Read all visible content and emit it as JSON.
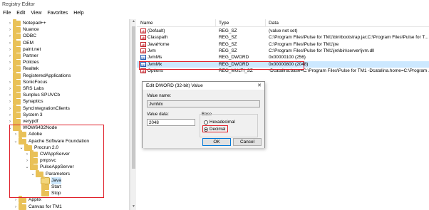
{
  "window": {
    "title": "Registry Editor"
  },
  "menu": [
    "File",
    "Edit",
    "View",
    "Favorites",
    "Help"
  ],
  "tree": [
    {
      "label": "Notepad++",
      "indent": 2,
      "chevron": ">"
    },
    {
      "label": "Nuance",
      "indent": 2,
      "chevron": ">"
    },
    {
      "label": "ODBC",
      "indent": 2,
      "chevron": ">"
    },
    {
      "label": "OEM",
      "indent": 2,
      "chevron": ">"
    },
    {
      "label": "paint.net",
      "indent": 2,
      "chevron": ">"
    },
    {
      "label": "Partner",
      "indent": 2,
      "chevron": ">"
    },
    {
      "label": "Policies",
      "indent": 2,
      "chevron": ">"
    },
    {
      "label": "Realtek",
      "indent": 2,
      "chevron": ">"
    },
    {
      "label": "RegisteredApplications",
      "indent": 2,
      "chevron": ""
    },
    {
      "label": "SonicFocus",
      "indent": 2,
      "chevron": ">"
    },
    {
      "label": "SRS Labs",
      "indent": 2,
      "chevron": ">"
    },
    {
      "label": "Sunplus SPUVCb",
      "indent": 2,
      "chevron": ">"
    },
    {
      "label": "Synaptics",
      "indent": 2,
      "chevron": ">"
    },
    {
      "label": "SyncIntegrationClients",
      "indent": 2,
      "chevron": ">"
    },
    {
      "label": "System 3",
      "indent": 2,
      "chevron": ">"
    },
    {
      "label": "verypdf",
      "indent": 2,
      "chevron": ">"
    },
    {
      "label": "WOW6432Node",
      "indent": 2,
      "chevron": "v"
    },
    {
      "label": "Adobe",
      "indent": 3,
      "chevron": ">"
    },
    {
      "label": "Apache Software Foundation",
      "indent": 3,
      "chevron": "v"
    },
    {
      "label": "Procrun 2.0",
      "indent": 4,
      "chevron": "v"
    },
    {
      "label": "CWAppServer",
      "indent": 5,
      "chevron": ">"
    },
    {
      "label": "pmpsvc",
      "indent": 5,
      "chevron": ">"
    },
    {
      "label": "PulseAppServer",
      "indent": 5,
      "chevron": "v"
    },
    {
      "label": "Parameters",
      "indent": 6,
      "chevron": "v"
    },
    {
      "label": "Java",
      "indent": 7,
      "chevron": "",
      "selected": true
    },
    {
      "label": "Start",
      "indent": 7,
      "chevron": ""
    },
    {
      "label": "Stop",
      "indent": 7,
      "chevron": ""
    },
    {
      "label": "Applix",
      "indent": 3,
      "chevron": ">"
    },
    {
      "label": "Canvas for TM1",
      "indent": 3,
      "chevron": ">"
    }
  ],
  "list": {
    "headers": {
      "name": "Name",
      "type": "Type",
      "data": "Data"
    },
    "rows": [
      {
        "icon": "ab",
        "name": "(Default)",
        "type": "REG_SZ",
        "data": "(value not set)"
      },
      {
        "icon": "ab",
        "name": "Classpath",
        "type": "REG_SZ",
        "data": "C:\\Program Files\\Pulse for TM1\\bin\\bootstrap.jar;C:\\Program Files\\Pulse for T..."
      },
      {
        "icon": "ab",
        "name": "JavaHome",
        "type": "REG_SZ",
        "data": "C:\\Program Files\\Pulse for TM1\\jre"
      },
      {
        "icon": "ab",
        "name": "Jvm",
        "type": "REG_SZ",
        "data": "C:\\Program Files\\Pulse for TM1\\jre\\bin\\server\\jvm.dll"
      },
      {
        "icon": "bin",
        "name": "JvmMs",
        "type": "REG_DWORD",
        "data": "0x00000100 (256)"
      },
      {
        "icon": "bin",
        "name": "JvmMx",
        "type": "REG_DWORD",
        "data": "0x00000800 (2048)",
        "highlight": true
      },
      {
        "icon": "ab",
        "name": "Options",
        "type": "REG_MULTI_SZ",
        "data": "-Dcatalina.base=C:\\Program Files\\Pulse for TM1 -Dcatalina.home=C:\\Program ..."
      }
    ]
  },
  "dialog": {
    "title": "Edit DWORD (32-bit) Value",
    "value_name_label": "Value name:",
    "value_name": "JvmMx",
    "value_data_label": "Value data:",
    "value_data": "2048",
    "base_label": "Base",
    "hex_label": "Hexadecimal",
    "dec_label": "Decimal",
    "ok_label": "OK",
    "cancel_label": "Cancel",
    "close_glyph": "✕"
  },
  "icons": {
    "chevron_right": "›",
    "chevron_down": "⌄"
  }
}
